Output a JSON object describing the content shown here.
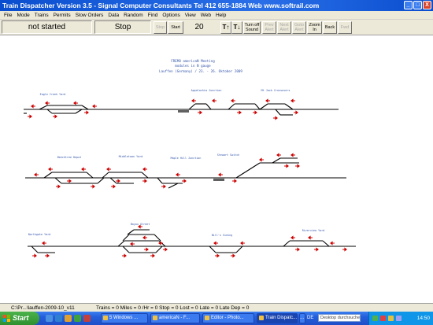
{
  "window": {
    "title": "Train Dispatcher Version 3.5 - Signal Computer Consultants Tel 412 655-1884 Web www.softrail.com",
    "controls": [
      "_",
      "□",
      "X"
    ]
  },
  "menu": [
    "File",
    "Mode",
    "Trains",
    "Permits",
    "Slow Orders",
    "Data",
    "Random",
    "Find",
    "Options",
    "View",
    "Web",
    "Help"
  ],
  "toolbar": {
    "status": "not started",
    "run_state": "Stop",
    "stop_label": "Stop",
    "start_label": "Start",
    "speed": "20",
    "speed_up": "T↑",
    "speed_down": "T↓",
    "turn_off_sound": "Turn off Sound",
    "prev_alert": "Prev Alert",
    "next_alert": "Next Alert",
    "goto_alert": "Goto Alert",
    "zoom_in": "Zoom In",
    "back": "Back",
    "fwd": "Fwd"
  },
  "layout_title": {
    "line1": "FREMO americaN Meeting",
    "line2": "modules in N gauge",
    "line3": "Lauffen (Germany) / 23. - 26. Oktober 2009"
  },
  "stations": [
    "Eagle Creek Yard",
    "Appalachia Junction",
    "Mt Jack Crossovers",
    "Beechtree Depot",
    "Middletown Yard",
    "Maple Hill Junction",
    "Stewart Switch",
    "Northgate Yard",
    "Bayou Street",
    "Bill's Siding",
    "Riverview Yard"
  ],
  "statusbar": {
    "file": "C:\\Pr...\\lauffen-2009-10_v11",
    "stats": "Trains = 0  Miles = 0  /Hr = 0  Stop = 0  Lost = 0  Late = 0  Late Dep = 0"
  },
  "taskbar": {
    "start": "Start",
    "tasks": [
      "5 Windows ...",
      "americaN - F...",
      "Editor - Photo...",
      "Train Dispatc...",
      "..."
    ],
    "language": "DE",
    "search_placeholder": "Desktop durchsuchen",
    "clock": "14:50"
  },
  "colors": {
    "title_bar": "#0a4ecf",
    "track": "#000000",
    "signal": "#cc0000",
    "platform": "#606060",
    "station_label": "#3355aa"
  }
}
